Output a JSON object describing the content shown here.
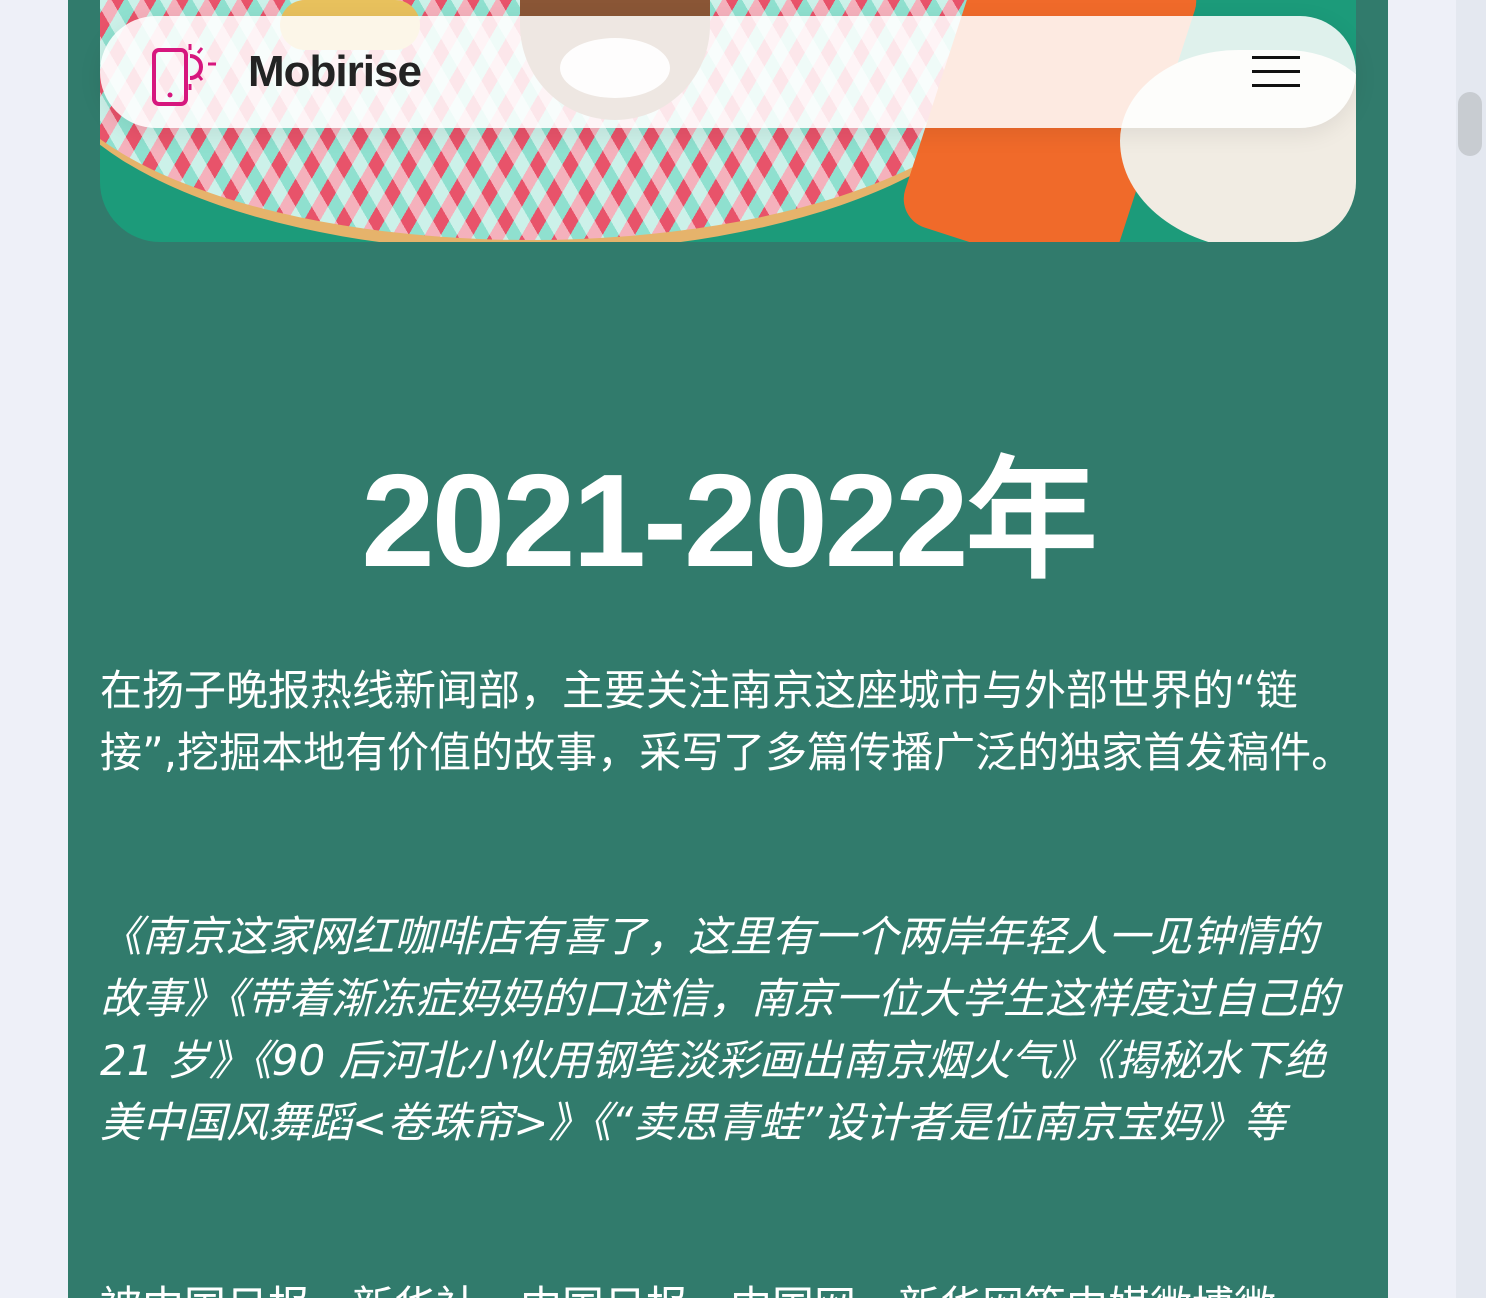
{
  "nav": {
    "brand": "Mobirise",
    "menu_icon": "hamburger-menu-icon",
    "logo_icon": "phone-sun-icon"
  },
  "section": {
    "title": "2021-2022年",
    "paragraph1": "在扬子晚报热线新闻部，主要关注南京这座城市与外部世界的“链接”,挖掘本地有价值的故事，采写了多篇传播广泛的独家首发稿件。",
    "paragraph2": "《南京这家网红咖啡店有喜了，这里有一个两岸年轻人一见钟情的故事》《带着渐冻症妈妈的口述信，南京一位大学生这样度过自己的 21 岁》《90 后河北小伙用钢笔淡彩画出南京烟火气》《揭秘水下绝美中国风舞蹈<卷珠帘>》《“卖思青蛙”设计者是位南京宝妈》等",
    "paragraph3": "被中国日报、新华社、中国日报、中国网、新华网等中媒微博微"
  },
  "colors": {
    "section_bg": "#317b6c",
    "page_bg": "#eef0f8",
    "logo_accent": "#d6177e"
  }
}
